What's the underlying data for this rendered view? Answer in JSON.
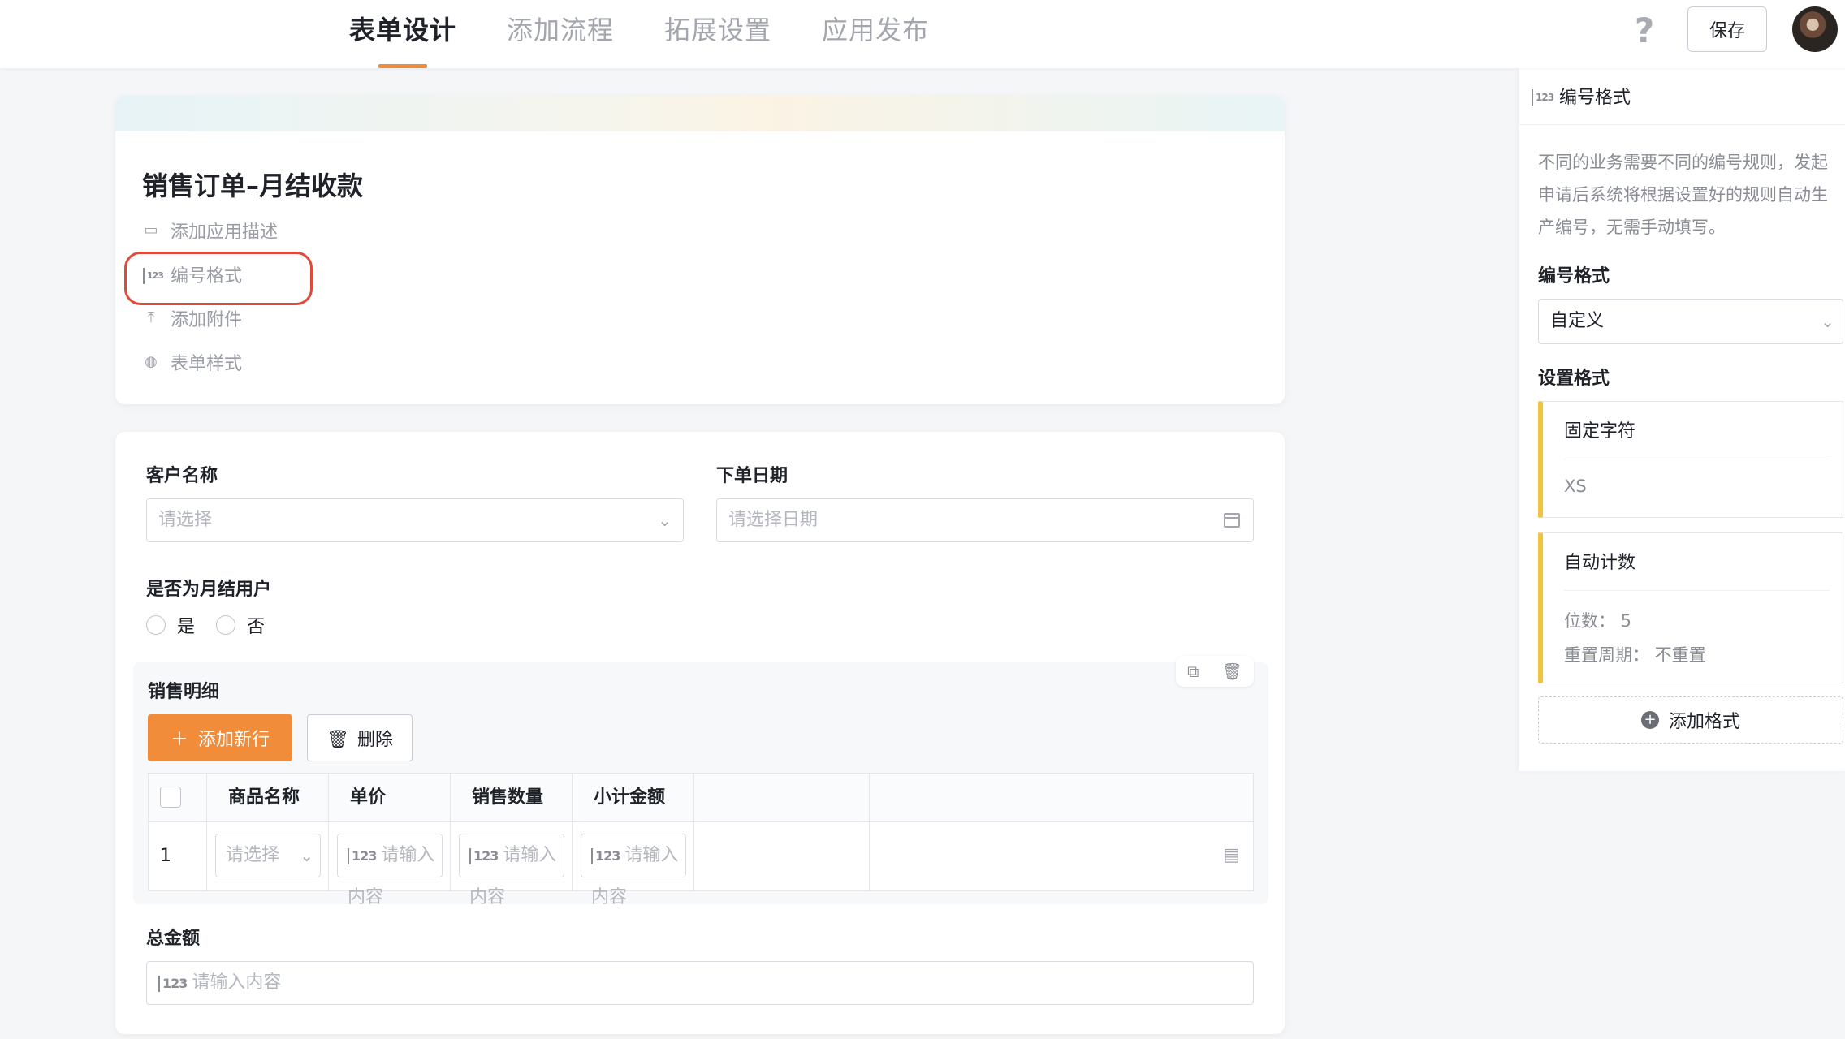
{
  "header": {
    "tabs": [
      {
        "label": "表单设计",
        "active": true
      },
      {
        "label": "添加流程",
        "active": false
      },
      {
        "label": "拓展设置",
        "active": false
      },
      {
        "label": "应用发布",
        "active": false
      }
    ],
    "help_label": "?",
    "save_label": "保存",
    "accent_color": "#f08c3a"
  },
  "form_header": {
    "title": "销售订单–月结收款",
    "items": [
      {
        "label": "添加应用描述",
        "icon": "comment-icon"
      },
      {
        "label": "编号格式",
        "icon": "number-format-icon"
      },
      {
        "label": "添加附件",
        "icon": "upload-icon"
      },
      {
        "label": "表单样式",
        "icon": "palette-icon"
      }
    ]
  },
  "fields": {
    "customer": {
      "label": "客户名称",
      "placeholder": "请选择"
    },
    "order_date": {
      "label": "下单日期",
      "placeholder": "请选择日期"
    },
    "monthly": {
      "label": "是否为月结用户",
      "options": [
        "是",
        "否"
      ]
    },
    "total": {
      "label": "总金额",
      "placeholder": "请输入内容"
    }
  },
  "subform": {
    "title": "销售明细",
    "add_label": "添加新行",
    "delete_label": "删除",
    "columns": [
      "商品名称",
      "单价",
      "销售数量",
      "小计金额"
    ],
    "rows": [
      {
        "index": "1",
        "product": "请选择",
        "price": "请输入内容",
        "qty": "请输入内容",
        "subtotal": "请输入内容"
      }
    ]
  },
  "side_panel": {
    "title": "编号格式",
    "description": "不同的业务需要不同的编号规则，发起申请后系统将根据设置好的规则自动生产编号，无需手动填写。",
    "format_label": "编号格式",
    "format_value": "自定义",
    "settings_label": "设置格式",
    "fixed": {
      "title": "固定字符",
      "value": "XS"
    },
    "counter": {
      "title": "自动计数",
      "digits": "位数：  5",
      "reset": "重置周期：  不重置"
    },
    "add_label": "添加格式",
    "stripe_color": "#f1c440"
  }
}
